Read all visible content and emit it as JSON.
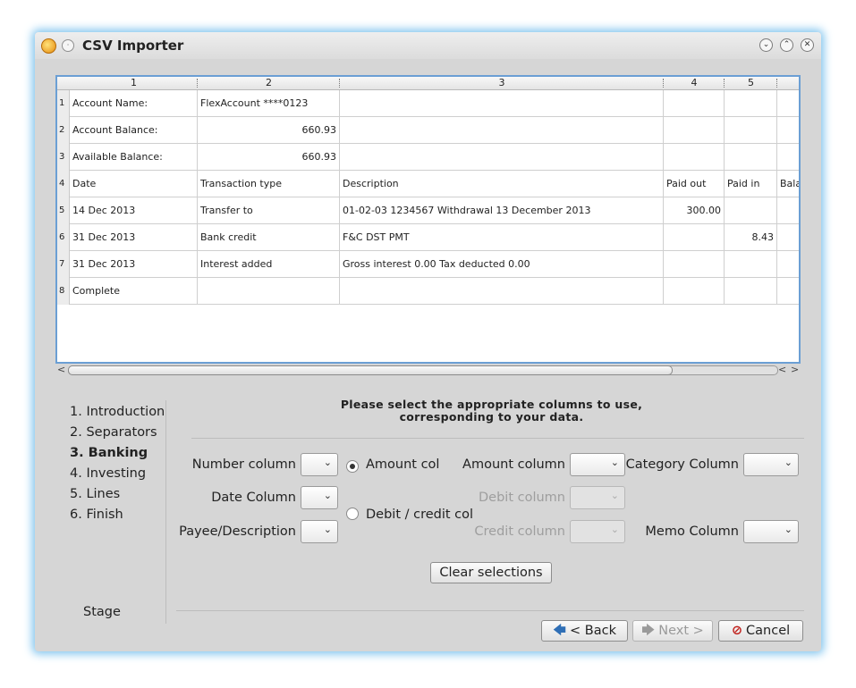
{
  "window": {
    "title": "CSV Importer",
    "menu_glyph": "·",
    "controls": {
      "minimize": "⌄",
      "maximize": "⌃",
      "close": "✕"
    }
  },
  "grid": {
    "column_headers": [
      "1",
      "2",
      "3",
      "4",
      "5"
    ],
    "row_headers": [
      "1",
      "2",
      "3",
      "4",
      "5",
      "6",
      "7",
      "8"
    ],
    "rows": [
      [
        "Account Name:",
        "FlexAccount ****0123",
        "",
        "",
        "",
        ""
      ],
      [
        "Account Balance:",
        "660.93",
        "",
        "",
        "",
        ""
      ],
      [
        "Available Balance:",
        "660.93",
        "",
        "",
        "",
        ""
      ],
      [
        "Date",
        "Transaction type",
        "Description",
        "Paid out",
        "Paid in",
        "Bala"
      ],
      [
        "14 Dec 2013",
        "Transfer to",
        "01-02-03 1234567 Withdrawal 13 December 2013",
        "300.00",
        "",
        ""
      ],
      [
        "31 Dec 2013",
        "Bank credit",
        "F&C DST PMT",
        "",
        "8.43",
        ""
      ],
      [
        "31 Dec 2013",
        "Interest added",
        "Gross interest 0.00 Tax deducted 0.00",
        "",
        "",
        ""
      ],
      [
        "Complete",
        "",
        "",
        "",
        "",
        ""
      ]
    ]
  },
  "stages": {
    "items": [
      "1. Introduction",
      "2. Separators",
      "3. Banking",
      "4. Investing",
      "5. Lines",
      "6. Finish"
    ],
    "current_index": 2,
    "label": "Stage"
  },
  "instructions": {
    "line1": "Please select the appropriate columns to use,",
    "line2": "corresponding to your data."
  },
  "fields": {
    "number_column": "Number column",
    "date_column": "Date Column",
    "payee_description": "Payee/Description",
    "amount_col_radio": "Amount col",
    "debit_credit_radio": "Debit / credit col",
    "amount_column": "Amount column",
    "debit_column": "Debit column",
    "credit_column": "Credit column",
    "category_column": "Category Column",
    "memo_column": "Memo Column",
    "selected_radio": "amount",
    "chevron": "⌄"
  },
  "buttons": {
    "clear": "Clear selections",
    "back": "< Back",
    "next": "Next >",
    "cancel": "Cancel",
    "back_icon": "🡄",
    "next_icon": "🡆",
    "cancel_icon": "⊘"
  },
  "colors": {
    "accent": "#6b9fd4",
    "glow": "#7fc4ee",
    "cancel_icon": "#c0201c",
    "back_icon": "#2f6fb6"
  }
}
